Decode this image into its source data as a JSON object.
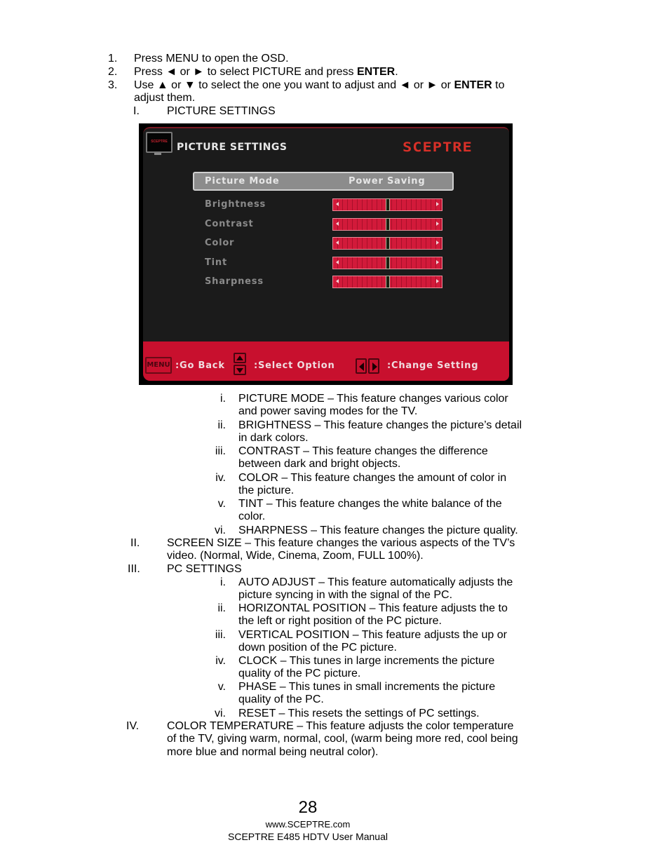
{
  "steps": [
    {
      "num": "1.",
      "parts": [
        {
          "t": "Press MENU to open the OSD."
        }
      ]
    },
    {
      "num": "2.",
      "parts": [
        {
          "t": "Press ◄ or ► to select PICTURE and press "
        },
        {
          "t": "ENTER",
          "bold": true
        },
        {
          "t": "."
        }
      ]
    },
    {
      "num": "3.",
      "parts": [
        {
          "t": "Use ▲ or ▼ to select the one you want to adjust and ◄ or ► or "
        },
        {
          "t": "ENTER",
          "bold": true
        },
        {
          "t": " to"
        }
      ],
      "continuation": "adjust them."
    }
  ],
  "sections": {
    "I": {
      "num": "I.",
      "title": "PICTURE SETTINGS"
    },
    "II": {
      "num": "II.",
      "line1": "SCREEN SIZE – This feature changes the various aspects of the TV’s",
      "line2": "video.  (Normal, Wide, Cinema, Zoom, FULL 100%)."
    },
    "III": {
      "num": "III.",
      "title": "PC SETTINGS"
    },
    "IV": {
      "num": "IV.",
      "line1": "COLOR TEMPERATURE – This feature adjusts the color temperature",
      "line2": "of the TV, giving warm, normal, cool, (warm being more red, cool being",
      "line3": "more blue and normal being neutral color)."
    }
  },
  "osd": {
    "tv_icon_text": "SCEPTRE",
    "title": "PICTURE SETTINGS",
    "brand": "SCEPTRE",
    "selected": {
      "label": "Picture Mode",
      "value": "Power Saving"
    },
    "sliders": [
      {
        "label": "Brightness",
        "value_fraction": 0.5
      },
      {
        "label": "Contrast",
        "value_fraction": 0.5
      },
      {
        "label": "Color",
        "value_fraction": 0.5
      },
      {
        "label": "Tint",
        "value_fraction": 0.5
      },
      {
        "label": "Sharpness",
        "value_fraction": 0.5
      }
    ],
    "footer": {
      "menu_key": "MENU",
      "go_back": ":Go Back",
      "select_option": ":Select Option",
      "change_setting": ":Change Setting"
    },
    "colors": {
      "accent_red": "#c8102e",
      "brand_red": "#d83028",
      "background": "#1b1b1b"
    }
  },
  "picture_items": [
    {
      "num": "i.",
      "l1": "PICTURE MODE – This feature changes various color",
      "l2": "and power saving modes for the TV."
    },
    {
      "num": "ii.",
      "l1": "BRIGHTNESS – This feature changes the picture’s detail",
      "l2": "in dark colors."
    },
    {
      "num": "iii.",
      "l1": "CONTRAST – This feature changes the difference",
      "l2": "between dark and bright objects."
    },
    {
      "num": "iv.",
      "l1": "COLOR – This feature changes the amount of color in",
      "l2": "the picture."
    },
    {
      "num": "v.",
      "l1": "TINT – This feature changes the white balance of the",
      "l2": "color."
    },
    {
      "num": "vi.",
      "l1": "SHARPNESS – This feature changes the picture quality.",
      "l2": ""
    }
  ],
  "pc_items": [
    {
      "num": "i.",
      "l1": "AUTO ADJUST – This feature automatically adjusts the",
      "l2": "picture syncing in with the signal of the PC."
    },
    {
      "num": "ii.",
      "l1": "HORIZONTAL POSITION – This feature adjusts the to",
      "l2": "the left or right position of the PC picture."
    },
    {
      "num": "iii.",
      "l1": "VERTICAL POSITION – This feature adjusts the up or",
      "l2": "down position of the PC picture."
    },
    {
      "num": "iv.",
      "l1": "CLOCK – This tunes in large increments the picture",
      "l2": "quality of the PC picture."
    },
    {
      "num": "v.",
      "l1": "PHASE – This tunes in small increments the picture",
      "l2": "quality of the PC."
    },
    {
      "num": "vi.",
      "l1": "RESET – This resets the settings of PC settings.",
      "l2": ""
    }
  ],
  "page_footer": {
    "page_number": "28",
    "website": "www.SCEPTRE.com",
    "manual": "SCEPTRE E485 HDTV User Manual"
  }
}
